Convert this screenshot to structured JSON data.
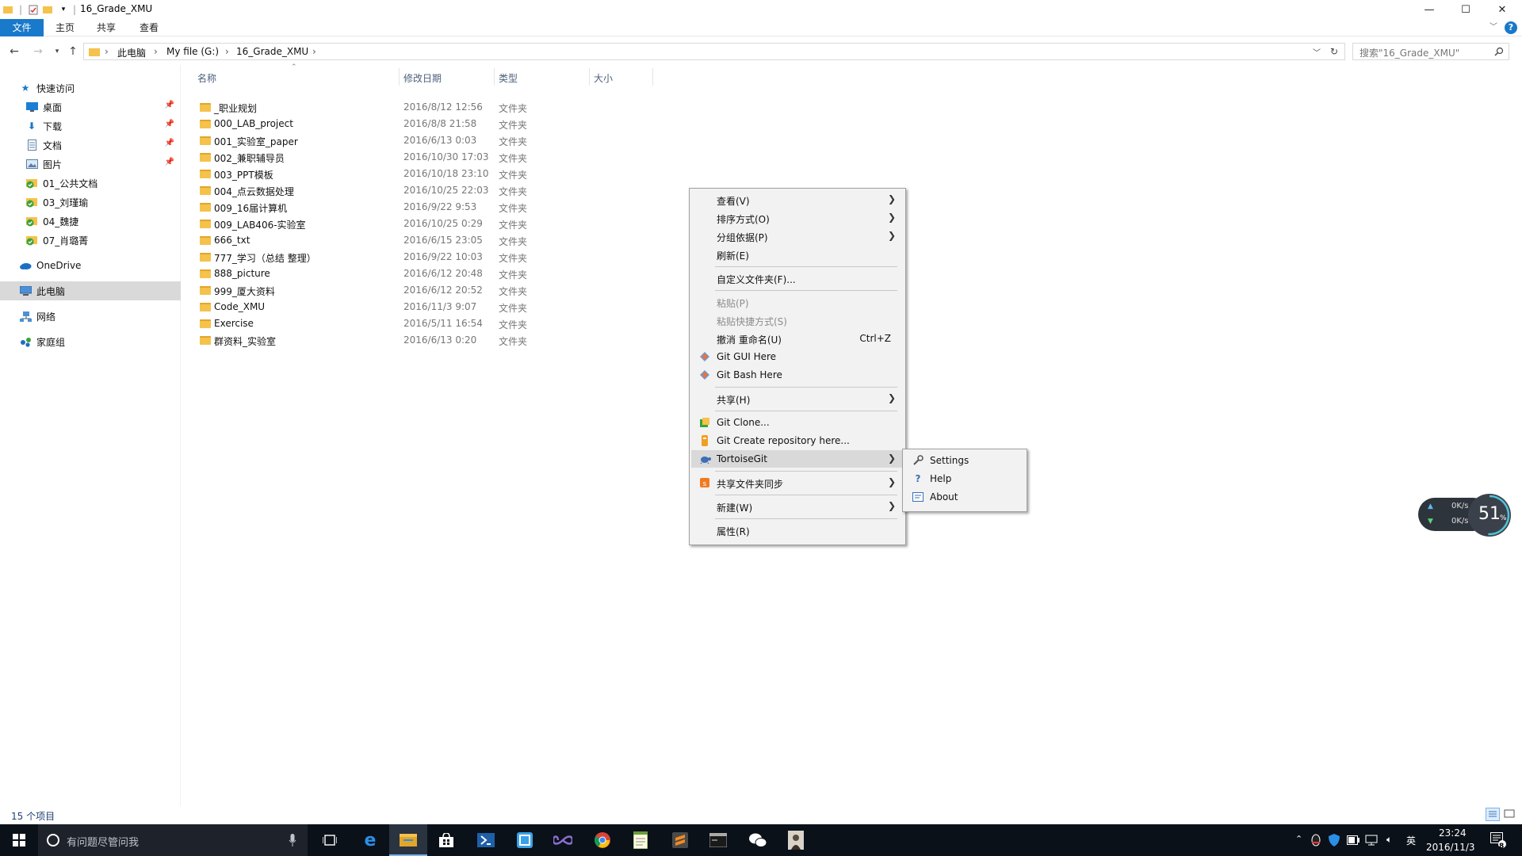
{
  "window": {
    "title": "16_Grade_XMU",
    "controls": {
      "minimize": "—",
      "maximize": "☐",
      "close": "✕"
    }
  },
  "ribbon": {
    "tabs": [
      "文件",
      "主页",
      "共享",
      "查看"
    ]
  },
  "address": {
    "crumbs": [
      "此电脑",
      "My file (G:)",
      "16_Grade_XMU"
    ],
    "search_placeholder": "搜索\"16_Grade_XMU\""
  },
  "nav": {
    "quick_access": "快速访问",
    "pinned": [
      {
        "label": "桌面",
        "icon": "desktop-icon"
      },
      {
        "label": "下载",
        "icon": "download-icon"
      },
      {
        "label": "文档",
        "icon": "document-icon"
      },
      {
        "label": "图片",
        "icon": "picture-icon"
      }
    ],
    "recent": [
      "01_公共文档",
      "03_刘瑾瑜",
      "04_魏捷",
      "07_肖璐菁"
    ],
    "onedrive": "OneDrive",
    "this_pc": "此电脑",
    "network": "网络",
    "homegroup": "家庭组"
  },
  "columns": {
    "name": "名称",
    "modified": "修改日期",
    "type": "类型",
    "size": "大小"
  },
  "files": [
    {
      "name": "_职业规划",
      "date": "2016/8/12 12:56",
      "type": "文件夹"
    },
    {
      "name": "000_LAB_project",
      "date": "2016/8/8 21:58",
      "type": "文件夹"
    },
    {
      "name": "001_实验室_paper",
      "date": "2016/6/13 0:03",
      "type": "文件夹"
    },
    {
      "name": "002_兼职辅导员",
      "date": "2016/10/30 17:03",
      "type": "文件夹"
    },
    {
      "name": "003_PPT模板",
      "date": "2016/10/18 23:10",
      "type": "文件夹"
    },
    {
      "name": "004_点云数据处理",
      "date": "2016/10/25 22:03",
      "type": "文件夹"
    },
    {
      "name": "009_16届计算机",
      "date": "2016/9/22 9:53",
      "type": "文件夹"
    },
    {
      "name": "009_LAB406-实验室",
      "date": "2016/10/25 0:29",
      "type": "文件夹"
    },
    {
      "name": "666_txt",
      "date": "2016/6/15 23:05",
      "type": "文件夹"
    },
    {
      "name": "777_学习（总结 整理）",
      "date": "2016/9/22 10:03",
      "type": "文件夹"
    },
    {
      "name": "888_picture",
      "date": "2016/6/12 20:48",
      "type": "文件夹"
    },
    {
      "name": "999_厦大资料",
      "date": "2016/6/12 20:52",
      "type": "文件夹"
    },
    {
      "name": "Code_XMU",
      "date": "2016/11/3 9:07",
      "type": "文件夹"
    },
    {
      "name": "Exercise",
      "date": "2016/5/11 16:54",
      "type": "文件夹"
    },
    {
      "name": "群资料_实验室",
      "date": "2016/6/13 0:20",
      "type": "文件夹"
    }
  ],
  "context_menu": {
    "view": "查看(V)",
    "sort": "排序方式(O)",
    "group": "分组依据(P)",
    "refresh": "刷新(E)",
    "customize": "自定义文件夹(F)...",
    "paste": "粘贴(P)",
    "paste_shortcut": "粘贴快捷方式(S)",
    "undo": "撤消 重命名(U)",
    "undo_shortcut": "Ctrl+Z",
    "git_gui": "Git GUI Here",
    "git_bash": "Git Bash Here",
    "share": "共享(H)",
    "git_clone": "Git Clone...",
    "git_create": "Git Create repository here...",
    "tortoisegit": "TortoiseGit",
    "sync": "共享文件夹同步",
    "new": "新建(W)",
    "properties": "属性(R)"
  },
  "submenu": {
    "settings": "Settings",
    "help": "Help",
    "about": "About"
  },
  "status": {
    "count": "15 个项目"
  },
  "net_widget": {
    "up": "0K/s",
    "down": "0K/s",
    "percent": "51",
    "unit": "%"
  },
  "taskbar": {
    "search_placeholder": "有问题尽管问我",
    "time": "23:24",
    "date": "2016/11/3",
    "ime": "英",
    "notif_count": "8"
  }
}
